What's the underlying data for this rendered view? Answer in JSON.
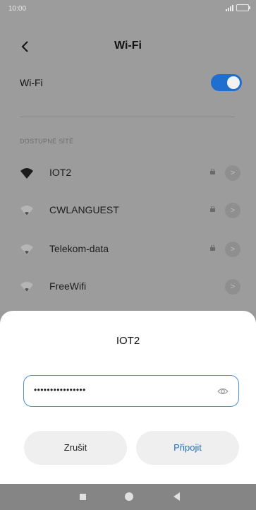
{
  "status_bar": {
    "time": "10:00",
    "battery": "",
    "signal_icon": "signal-icon",
    "battery_icon": "battery-icon"
  },
  "header": {
    "title": "Wi-Fi",
    "back_icon": "chevron-left-icon"
  },
  "wifi": {
    "label": "Wi-Fi",
    "enabled": true,
    "toggle_color": "#1f6fd1"
  },
  "section": {
    "title": "DOSTUPNÉ SÍTĚ"
  },
  "networks": [
    {
      "name": "IOT2",
      "locked": true,
      "strength": "full"
    },
    {
      "name": "CWLANGUEST",
      "locked": true,
      "strength": "weak"
    },
    {
      "name": "Telekom-data",
      "locked": true,
      "strength": "weak"
    },
    {
      "name": "FreeWifi",
      "locked": false,
      "strength": "weak"
    }
  ],
  "dialog": {
    "title": "IOT2",
    "password_value": "••••••••••••••••",
    "eye_icon": "eye-icon",
    "cancel_label": "Zrušit",
    "connect_label": "Připojit",
    "accent": "#1f6fd1"
  },
  "navbar": {
    "icons": [
      "recents-icon",
      "home-icon",
      "back-icon"
    ]
  }
}
